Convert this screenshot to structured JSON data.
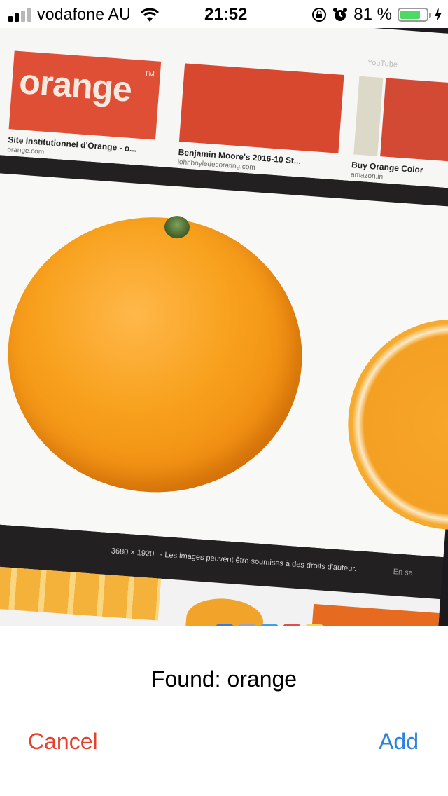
{
  "status_bar": {
    "carrier": "vodafone AU",
    "time": "21:52",
    "battery_percent": "81 %",
    "battery_level": 0.81,
    "battery_color": "#4cd964",
    "icons": [
      "signal-icon",
      "wifi-icon",
      "rotation-lock-icon",
      "alarm-icon",
      "battery-icon",
      "charging-icon"
    ]
  },
  "camera_view": {
    "results": [
      {
        "logo_text": "orange",
        "logo_tm": "TM",
        "caption": "Site institutionnel d'Orange - o...",
        "source": "orange.com"
      },
      {
        "caption": "Benjamin Moore's 2016-10 St...",
        "source": "johnboyledecorating.com"
      },
      {
        "caption": "Buy Orange Color",
        "source": "amazon.in"
      }
    ],
    "top_right_label": "YouTube",
    "image_size": "3680 × 1920",
    "rights_notice": "- Les images peuvent être soumises à des droits d'auteur.",
    "rights_tail": "En sa",
    "nav_arrow": "‹"
  },
  "sheet": {
    "found_text": "Found: orange",
    "cancel_label": "Cancel",
    "add_label": "Add",
    "cancel_color": "#e7402e",
    "add_color": "#2b83e0"
  }
}
